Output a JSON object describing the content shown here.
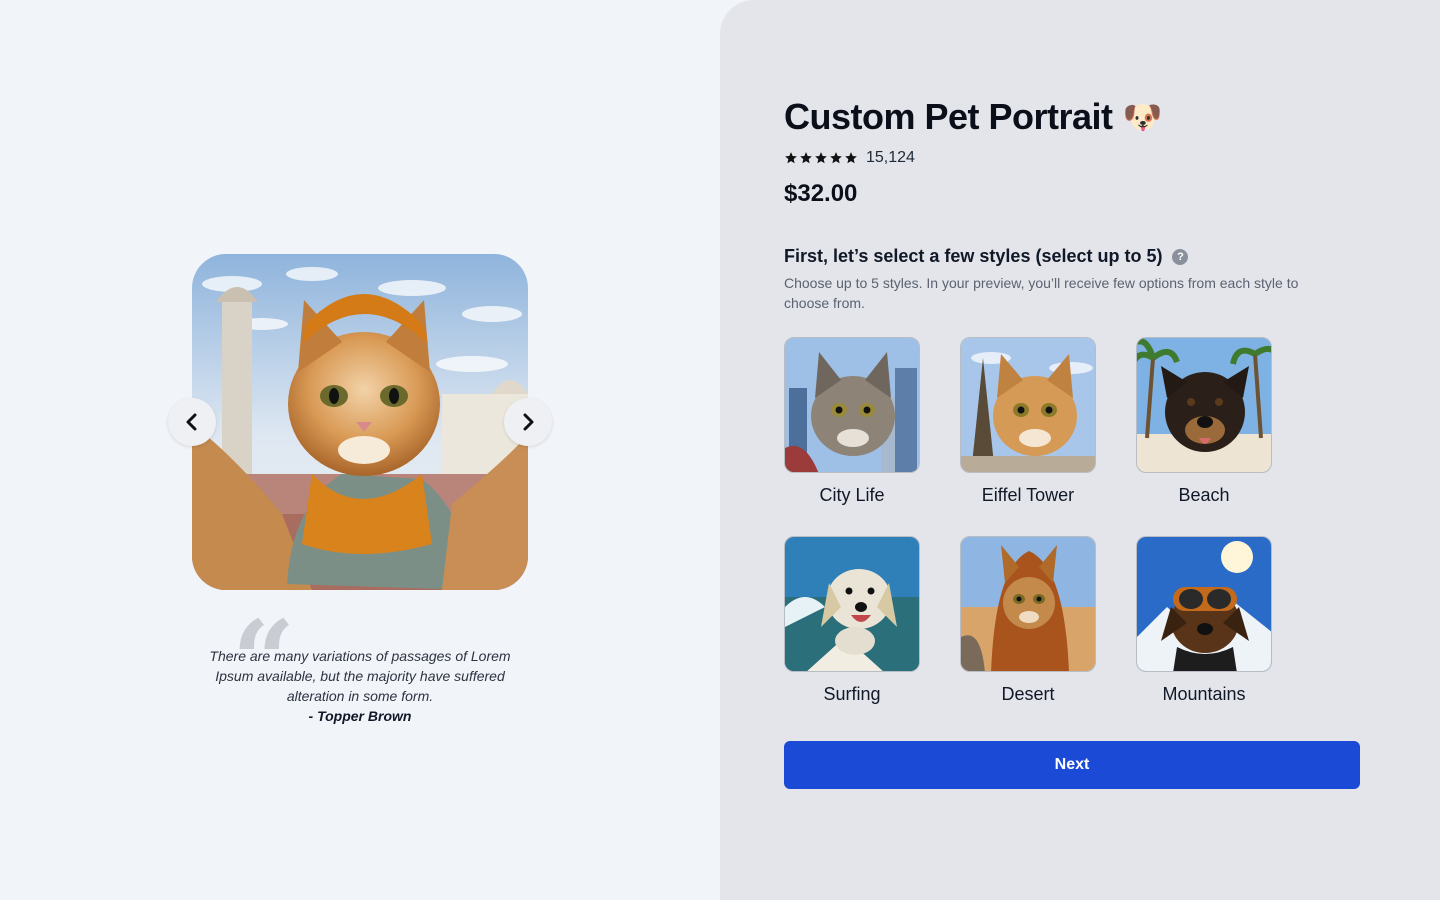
{
  "product": {
    "title": "Custom Pet Portrait",
    "title_emoji": "🐶",
    "rating_stars": 5,
    "review_count": "15,124",
    "price": "$32.00"
  },
  "styles_section": {
    "heading": "First, let’s select a few styles (select up to 5)",
    "help_icon": "question-mark-circle-icon",
    "description": "Choose up to 5 styles. In your preview, you’ll receive few options from each style to choose from.",
    "options": [
      {
        "label": "City Life"
      },
      {
        "label": "Eiffel Tower"
      },
      {
        "label": "Beach"
      },
      {
        "label": "Surfing"
      },
      {
        "label": "Desert"
      },
      {
        "label": "Mountains"
      }
    ]
  },
  "next_button": {
    "label": "Next"
  },
  "carousel": {
    "prev_icon": "chevron-left-icon",
    "next_icon": "chevron-right-icon"
  },
  "testimonial": {
    "quote": "There are many variations of passages of Lorem Ipsum available, but the majority have suffered alteration in some form.",
    "author": "- Topper Brown"
  },
  "colors": {
    "page_bg": "#f1f4f9",
    "panel_bg": "#e3e5ea",
    "primary_button": "#1b4bd6"
  }
}
